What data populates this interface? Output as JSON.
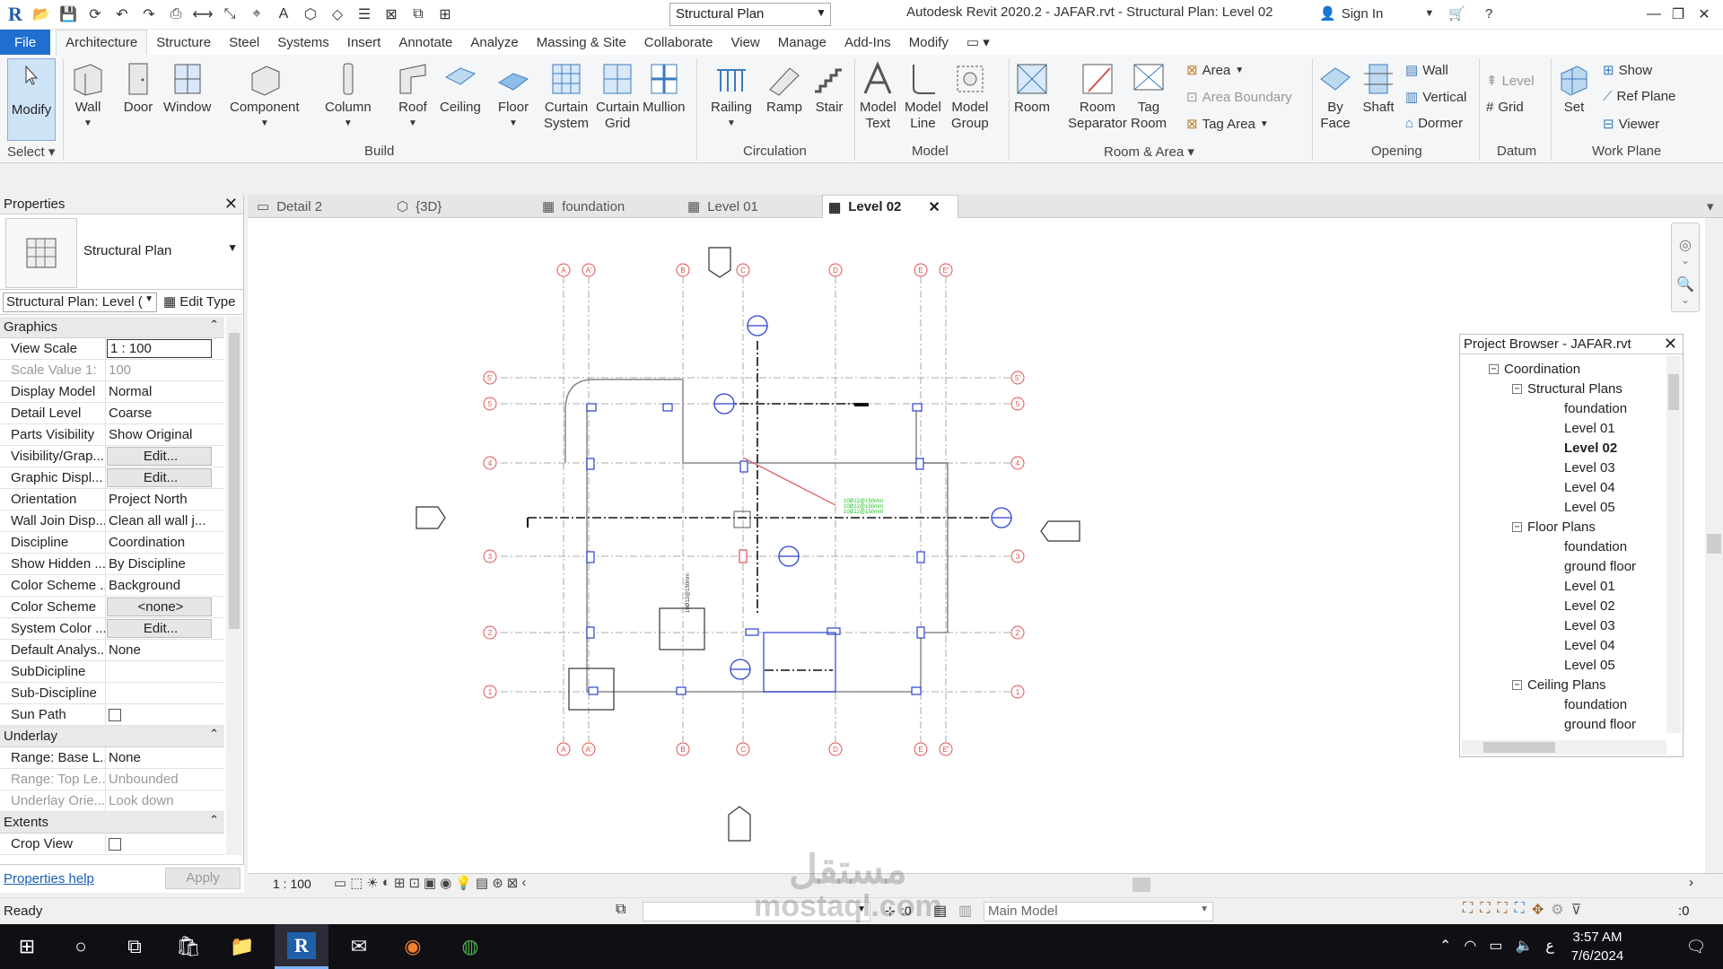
{
  "titlebar": {
    "title": "Autodesk Revit 2020.2 - JAFAR.rvt - Structural Plan: Level 02",
    "view_type": "Structural Plan",
    "signin": "Sign In"
  },
  "menu": {
    "file": "File",
    "tabs": [
      "Architecture",
      "Structure",
      "Steel",
      "Systems",
      "Insert",
      "Annotate",
      "Analyze",
      "Massing & Site",
      "Collaborate",
      "View",
      "Manage",
      "Add-Ins",
      "Modify"
    ]
  },
  "ribbon": {
    "modify": "Modify",
    "select": "Select",
    "build": {
      "label": "Build",
      "wall": "Wall",
      "door": "Door",
      "window": "Window",
      "component": "Component",
      "column": "Column",
      "roof": "Roof",
      "ceiling": "Ceiling",
      "floor": "Floor",
      "curtain_system": "Curtain\nSystem",
      "curtain_grid": "Curtain\nGrid",
      "mullion": "Mullion"
    },
    "circulation": {
      "label": "Circulation",
      "railing": "Railing",
      "ramp": "Ramp",
      "stair": "Stair"
    },
    "model": {
      "label": "Model",
      "model_text": "Model\nText",
      "model_line": "Model\nLine",
      "model_group": "Model\nGroup"
    },
    "room": {
      "label": "Room & Area",
      "room": "Room",
      "room_separator": "Room\nSeparator",
      "tag_room": "Tag\nRoom",
      "area": "Area",
      "area_boundary": "Area  Boundary",
      "tag_area": "Tag  Area"
    },
    "opening": {
      "label": "Opening",
      "by_face": "By\nFace",
      "shaft": "Shaft",
      "wall": "Wall",
      "vertical": "Vertical",
      "dormer": "Dormer"
    },
    "datum": {
      "label": "Datum",
      "level": "Level",
      "grid": "Grid"
    },
    "workplane": {
      "label": "Work Plane",
      "set": "Set",
      "show": "Show",
      "ref_plane": "Ref  Plane",
      "viewer": "Viewer"
    }
  },
  "properties": {
    "title": "Properties",
    "type_name": "Structural Plan",
    "instance": "Structural Plan: Level (",
    "edit_type": "Edit Type",
    "graphics": {
      "label": "Graphics",
      "rows": [
        {
          "k": "View Scale",
          "v": "1 : 100"
        },
        {
          "k": "Scale Value    1:",
          "v": "100"
        },
        {
          "k": "Display Model",
          "v": "Normal"
        },
        {
          "k": "Detail Level",
          "v": "Coarse"
        },
        {
          "k": "Parts Visibility",
          "v": "Show Original"
        },
        {
          "k": "Visibility/Grap...",
          "v": "Edit..."
        },
        {
          "k": "Graphic Displ...",
          "v": "Edit..."
        },
        {
          "k": "Orientation",
          "v": "Project North"
        },
        {
          "k": "Wall Join Disp...",
          "v": "Clean all wall j..."
        },
        {
          "k": "Discipline",
          "v": "Coordination"
        },
        {
          "k": "Show Hidden ...",
          "v": "By Discipline"
        },
        {
          "k": "Color Scheme ...",
          "v": "Background"
        },
        {
          "k": "Color Scheme",
          "v": "<none>"
        },
        {
          "k": "System Color ...",
          "v": "Edit..."
        },
        {
          "k": "Default Analys...",
          "v": "None"
        },
        {
          "k": "SubDicipline",
          "v": ""
        },
        {
          "k": "Sub-Discipline",
          "v": ""
        },
        {
          "k": "Sun Path",
          "v": ""
        }
      ]
    },
    "underlay": {
      "label": "Underlay",
      "rows": [
        {
          "k": "Range: Base L...",
          "v": "None"
        },
        {
          "k": "Range: Top Le...",
          "v": "Unbounded"
        },
        {
          "k": "Underlay Orie...",
          "v": "Look down"
        }
      ]
    },
    "extents": {
      "label": "Extents",
      "rows": [
        {
          "k": "Crop View",
          "v": ""
        }
      ]
    },
    "help": "Properties help",
    "apply": "Apply"
  },
  "view_tabs": [
    "Detail 2",
    "{3D}",
    "foundation",
    "Level 01",
    "Level 02"
  ],
  "project_browser": {
    "title": "Project Browser - JAFAR.rvt",
    "root": "Coordination",
    "structural_plans": {
      "label": "Structural Plans",
      "items": [
        "foundation",
        "Level 01",
        "Level 02",
        "Level 03",
        "Level 04",
        "Level 05"
      ]
    },
    "floor_plans": {
      "label": "Floor Plans",
      "items": [
        "foundation",
        "ground floor",
        "Level 01",
        "Level 02",
        "Level 03",
        "Level 04",
        "Level 05"
      ]
    },
    "ceiling_plans": {
      "label": "Ceiling Plans",
      "items": [
        "foundation",
        "ground floor"
      ]
    }
  },
  "drawing": {
    "grid_top": [
      "A",
      "A'",
      "B",
      "C",
      "D",
      "E",
      "E'"
    ],
    "grid_side": [
      "5'",
      "5",
      "4",
      "3",
      "2",
      "1"
    ],
    "dim_text": "10Ø 12@150mm\n10Ø 12@150mm\n10Ø 12@150mm"
  },
  "viewbar": {
    "scale": "1 : 100"
  },
  "statusbar": {
    "status": "Ready",
    "selection": ":0",
    "model": "Main Model",
    "filter": ":0"
  },
  "taskbar": {
    "time": "3:57 AM",
    "date": "7/6/2024",
    "lang": "ع"
  },
  "watermark": {
    "arabic": "مستقل",
    "latin": "mostaql.com"
  },
  "colors": {
    "accent": "#1e6fd0",
    "grid": "#e05050",
    "selection": "#1a3fd0",
    "dim": "#20c020"
  }
}
